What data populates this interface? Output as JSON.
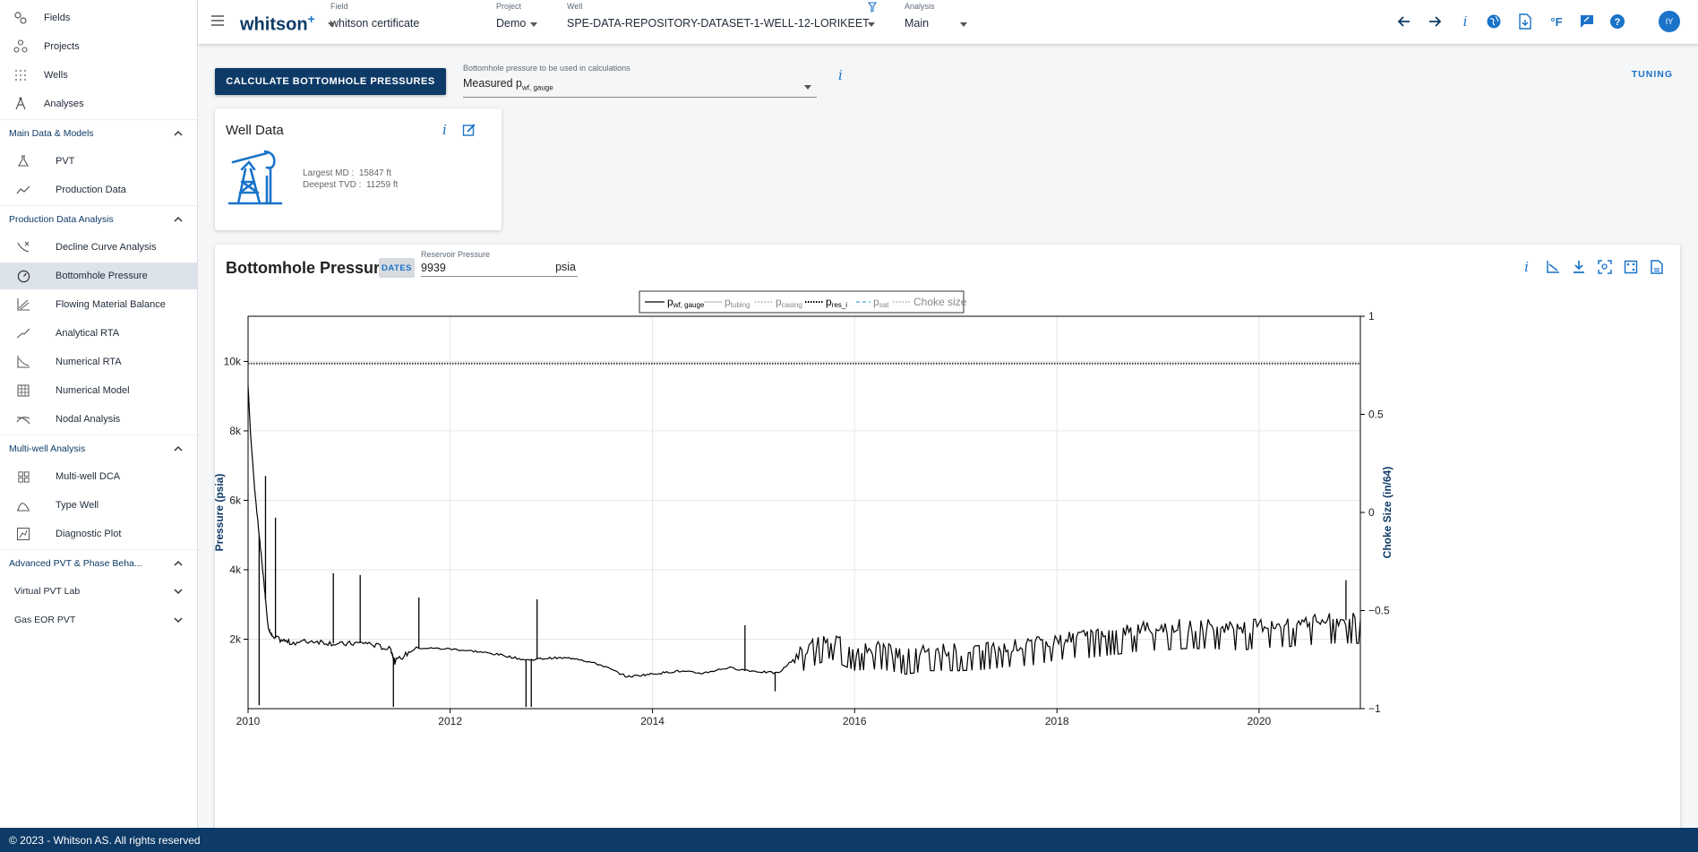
{
  "sidebar": {
    "top_items": [
      {
        "label": "Fields",
        "icon": "fields-icon"
      },
      {
        "label": "Projects",
        "icon": "projects-icon"
      },
      {
        "label": "Wells",
        "icon": "wells-icon"
      },
      {
        "label": "Analyses",
        "icon": "analyses-icon"
      }
    ],
    "sections": [
      {
        "title": "Main Data & Models",
        "expanded": true,
        "items": [
          {
            "label": "PVT",
            "icon": "flask-icon"
          },
          {
            "label": "Production Data",
            "icon": "trend-icon"
          }
        ]
      },
      {
        "title": "Production Data Analysis",
        "expanded": true,
        "items": [
          {
            "label": "Decline Curve Analysis",
            "icon": "decline-icon"
          },
          {
            "label": "Bottomhole Pressure",
            "icon": "gauge-icon",
            "active": true
          },
          {
            "label": "Flowing Material Balance",
            "icon": "fmb-icon"
          },
          {
            "label": "Analytical RTA",
            "icon": "rta-icon"
          },
          {
            "label": "Numerical RTA",
            "icon": "numerical-rta-icon"
          },
          {
            "label": "Numerical Model",
            "icon": "grid-model-icon"
          },
          {
            "label": "Nodal Analysis",
            "icon": "nodal-icon"
          }
        ]
      },
      {
        "title": "Multi-well Analysis",
        "expanded": true,
        "items": [
          {
            "label": "Multi-well DCA",
            "icon": "multiwell-icon"
          },
          {
            "label": "Type Well",
            "icon": "type-well-icon"
          },
          {
            "label": "Diagnostic Plot",
            "icon": "diagnostic-icon"
          }
        ]
      },
      {
        "title": "Advanced PVT & Phase Beha...",
        "expanded": true,
        "items": []
      }
    ],
    "sub_sections": [
      {
        "title": "Virtual PVT Lab"
      },
      {
        "title": "Gas EOR PVT"
      }
    ]
  },
  "topbar": {
    "logo": "whitson",
    "logo_plus": "+",
    "field_label": "Field",
    "field_value": "whitson certificate",
    "project_label": "Project",
    "project_value": "Demo",
    "well_label": "Well",
    "well_value": "SPE-DATA-REPOSITORY-DATASET-1-WELL-12-LORIKEET",
    "analysis_label": "Analysis",
    "analysis_value": "Main",
    "avatar": "IY",
    "temp_unit": "°F"
  },
  "main": {
    "calc_button": "CALCULATE BOTTOMHOLE PRESSURES",
    "bhp_select_label": "Bottomhole pressure to be used in calculations",
    "bhp_select_value": "Measured p",
    "bhp_select_sub": "wf, gauge",
    "tuning": "TUNING"
  },
  "well_card": {
    "title": "Well Data",
    "md_label": "Largest MD :",
    "md_value": "15847 ft",
    "tvd_label": "Deepest TVD :",
    "tvd_value": "11259 ft"
  },
  "bhp_card": {
    "title": "Bottomhole Pressure",
    "dates_badge": "DATES",
    "rp_label": "Reservoir Pressure",
    "rp_value": "9939",
    "rp_unit": "psia"
  },
  "chart_data": {
    "type": "line",
    "ylabel": "Pressure (psia)",
    "y2label": "Choke Size (in/64)",
    "xlim": [
      "2010-01-01",
      "2021-01-01"
    ],
    "ylim": [
      0,
      11300
    ],
    "y2lim": [
      -1,
      1
    ],
    "xticks": [
      "2010",
      "2012",
      "2014",
      "2016",
      "2018",
      "2020"
    ],
    "yticks": [
      {
        "v": 2000,
        "label": "2k"
      },
      {
        "v": 4000,
        "label": "4k"
      },
      {
        "v": 6000,
        "label": "6k"
      },
      {
        "v": 8000,
        "label": "8k"
      },
      {
        "v": 10000,
        "label": "10k"
      }
    ],
    "y2ticks": [
      {
        "v": 1,
        "label": "1"
      },
      {
        "v": 0.5,
        "label": "0.5"
      },
      {
        "v": 0,
        "label": "0"
      },
      {
        "v": -0.5,
        "label": "−0.5"
      },
      {
        "v": -1,
        "label": "−1"
      }
    ],
    "grid": true,
    "legend": [
      {
        "label": "p",
        "sub": "wf, gauge",
        "style": "solid-black"
      },
      {
        "label": "p",
        "sub": "tubing",
        "style": "solid-gray"
      },
      {
        "label": "p",
        "sub": "casing",
        "style": "dotted-gray"
      },
      {
        "label": "p",
        "sub": "res_i",
        "style": "dotted-black"
      },
      {
        "label": "p",
        "sub": "sat",
        "style": "dashed-blue"
      },
      {
        "label": "Choke size",
        "sub": "",
        "style": "dotted-gray"
      }
    ],
    "legend_position": "top-center",
    "series": [
      {
        "name": "pres_i",
        "constant": 9939
      },
      {
        "name": "pwf, gauge",
        "points": [
          [
            "2010-01-01",
            9300
          ],
          [
            "2010-01-10",
            7900
          ],
          [
            "2010-01-25",
            6300
          ],
          [
            "2010-02-10",
            5000
          ],
          [
            "2010-03-01",
            3500
          ],
          [
            "2010-03-15",
            2300
          ],
          [
            "2010-04-01",
            2050
          ],
          [
            "2010-06-01",
            1900
          ],
          [
            "2010-09-01",
            1950
          ],
          [
            "2010-12-01",
            1850
          ],
          [
            "2011-03-01",
            1900
          ],
          [
            "2011-06-01",
            1700
          ],
          [
            "2011-06-15",
            1350
          ],
          [
            "2011-09-01",
            1750
          ],
          [
            "2012-01-01",
            1720
          ],
          [
            "2012-04-01",
            1650
          ],
          [
            "2012-07-01",
            1550
          ],
          [
            "2012-10-01",
            1400
          ],
          [
            "2013-01-01",
            1460
          ],
          [
            "2013-04-01",
            1450
          ],
          [
            "2013-07-01",
            1250
          ],
          [
            "2013-10-01",
            920
          ],
          [
            "2014-01-01",
            1000
          ],
          [
            "2014-04-01",
            1080
          ],
          [
            "2014-07-01",
            1020
          ],
          [
            "2014-10-01",
            1180
          ],
          [
            "2015-01-01",
            1080
          ],
          [
            "2015-04-01",
            1020
          ],
          [
            "2015-07-01",
            1700
          ],
          [
            "2015-10-01",
            2050
          ],
          [
            "2016-01-01",
            1700
          ],
          [
            "2016-04-01",
            1750
          ],
          [
            "2016-07-01",
            1600
          ],
          [
            "2016-10-01",
            1700
          ],
          [
            "2017-01-01",
            1700
          ],
          [
            "2017-04-01",
            1720
          ],
          [
            "2017-07-01",
            1800
          ],
          [
            "2017-10-01",
            1850
          ],
          [
            "2018-01-01",
            2000
          ],
          [
            "2018-04-01",
            2100
          ],
          [
            "2018-07-01",
            2200
          ],
          [
            "2018-10-01",
            2300
          ],
          [
            "2019-01-01",
            2350
          ],
          [
            "2019-04-01",
            2400
          ],
          [
            "2019-07-01",
            2400
          ],
          [
            "2019-10-01",
            2350
          ],
          [
            "2020-01-01",
            2400
          ],
          [
            "2020-04-01",
            2450
          ],
          [
            "2020-07-01",
            2500
          ],
          [
            "2020-10-01",
            2550
          ],
          [
            "2021-01-01",
            2550
          ]
        ]
      }
    ],
    "spikes": [
      [
        "2010-02-10",
        100
      ],
      [
        "2010-03-05",
        6700
      ],
      [
        "2010-04-10",
        5500
      ],
      [
        "2010-11-05",
        3900
      ],
      [
        "2011-02-10",
        3850
      ],
      [
        "2011-06-10",
        50
      ],
      [
        "2011-09-10",
        3200
      ],
      [
        "2012-10-01",
        50
      ],
      [
        "2012-10-20",
        50
      ],
      [
        "2012-11-10",
        3150
      ],
      [
        "2014-12-01",
        2400
      ],
      [
        "2015-03-20",
        500
      ],
      [
        "2020-11-10",
        3700
      ]
    ]
  },
  "footer": {
    "text": "© 2023 - Whitson AS. All rights reserved"
  },
  "colors": {
    "navy": "#0d3a66",
    "accent": "#1a73c9",
    "active_bg": "#dde3ea"
  }
}
